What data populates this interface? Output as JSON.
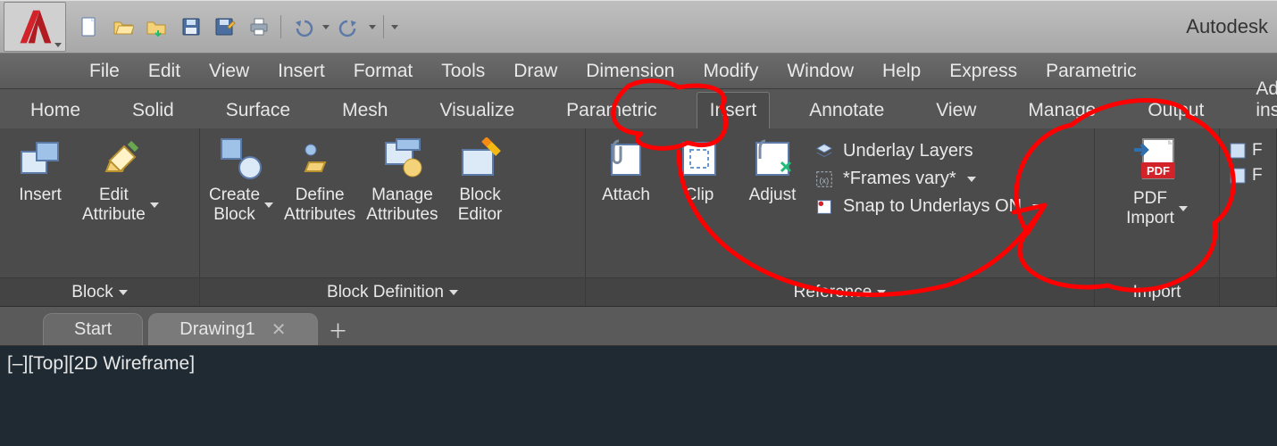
{
  "app": {
    "title_fragment": "Autodesk"
  },
  "qat": {
    "items": [
      {
        "name": "new-icon"
      },
      {
        "name": "open-icon"
      },
      {
        "name": "open-cloud-icon"
      },
      {
        "name": "save-icon"
      },
      {
        "name": "saveas-icon"
      },
      {
        "name": "print-icon"
      },
      {
        "name": "undo-icon"
      },
      {
        "name": "redo-icon"
      }
    ]
  },
  "menu": [
    "File",
    "Edit",
    "View",
    "Insert",
    "Format",
    "Tools",
    "Draw",
    "Dimension",
    "Modify",
    "Window",
    "Help",
    "Express",
    "Parametric"
  ],
  "ribbon_tabs": [
    "Home",
    "Solid",
    "Surface",
    "Mesh",
    "Visualize",
    "Parametric",
    "Insert",
    "Annotate",
    "View",
    "Manage",
    "Output",
    "Add-ins"
  ],
  "ribbon_active_tab": "Insert",
  "panels": {
    "block": {
      "title": "Block",
      "insert": "Insert",
      "edit_attr": "Edit\nAttribute"
    },
    "blockdef": {
      "title": "Block Definition",
      "create": "Create\nBlock",
      "define": "Define\nAttributes",
      "manage": "Manage\nAttributes",
      "editor": "Block\nEditor"
    },
    "reference": {
      "title": "Reference",
      "attach": "Attach",
      "clip": "Clip",
      "adjust": "Adjust",
      "underlay_layers": "Underlay Layers",
      "frames_vary": "*Frames vary*",
      "snap_underlays": "Snap to Underlays ON"
    },
    "import": {
      "title": "Import",
      "pdf_import": "PDF\nImport",
      "pdf_badge": "PDF"
    }
  },
  "doc_tabs": {
    "start": "Start",
    "drawing1": "Drawing1"
  },
  "viewport": {
    "status": "[–][Top][2D Wireframe]"
  }
}
